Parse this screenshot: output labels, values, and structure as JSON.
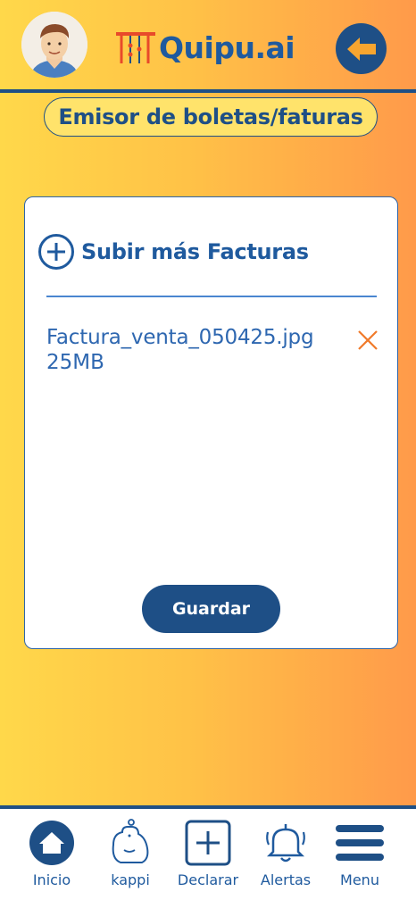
{
  "header": {
    "logo_text": "Quipu.ai"
  },
  "page": {
    "title": "Emisor de boletas/faturas"
  },
  "upload": {
    "label": "Subir más Facturas"
  },
  "files": [
    {
      "name": "Factura_venta_050425.jpg",
      "size": "25MB"
    }
  ],
  "actions": {
    "save_label": "Guardar"
  },
  "nav": {
    "items": [
      {
        "label": "Inicio",
        "icon": "home-icon"
      },
      {
        "label": "kappi",
        "icon": "capybara-icon"
      },
      {
        "label": "Declarar",
        "icon": "plus-square-icon"
      },
      {
        "label": "Alertas",
        "icon": "bell-icon"
      },
      {
        "label": "Menu",
        "icon": "hamburger-menu-icon"
      }
    ]
  },
  "colors": {
    "primary": "#1E4F86",
    "accent_orange": "#F07A2A",
    "gradient_start": "#FFD84A",
    "gradient_end": "#FF9A4A"
  }
}
